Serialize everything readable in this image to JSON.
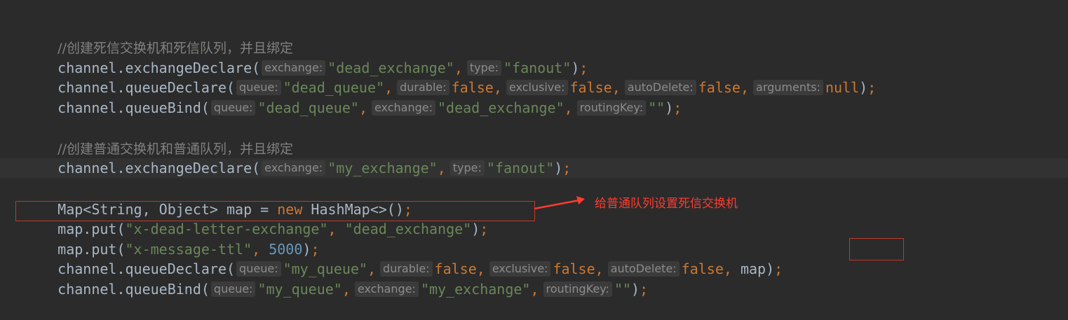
{
  "code": {
    "comment1": "//创建死信交换机和死信队列，并且绑定",
    "line_exchange_dead": {
      "method": "channel.exchangeDeclare(",
      "hint_exchange": "exchange:",
      "val_exchange": "\"dead_exchange\"",
      "hint_type": "type:",
      "val_type": "\"fanout\"",
      "end": ");"
    },
    "line_queue_dead": {
      "method": "channel.queueDeclare(",
      "hint_queue": "queue:",
      "val_queue": "\"dead_queue\"",
      "hint_durable": "durable:",
      "val_durable": "false",
      "hint_exclusive": "exclusive:",
      "val_exclusive": "false",
      "hint_autodelete": "autoDelete:",
      "val_autodelete": "false",
      "hint_arguments": "arguments:",
      "val_arguments": "null",
      "end": ");"
    },
    "line_bind_dead": {
      "method": "channel.queueBind(",
      "hint_queue": "queue:",
      "val_queue": "\"dead_queue\"",
      "hint_exchange": "exchange:",
      "val_exchange": "\"dead_exchange\"",
      "hint_routing": "routingKey:",
      "val_routing": "\"\"",
      "end": ");"
    },
    "comment2": "//创建普通交换机和普通队列，并且绑定",
    "line_exchange_my": {
      "method": "channel.exchangeDeclare(",
      "hint_exchange": "exchange:",
      "val_exchange": "\"my_exchange\"",
      "hint_type": "type:",
      "val_type": "\"fanout\"",
      "end": ");"
    },
    "line_map_decl": {
      "type": "Map<String, Object> map = ",
      "kw_new": "new",
      "ctor": " HashMap<>()",
      "end": ";"
    },
    "line_put_dlx": {
      "method": "map.put(",
      "key": "\"x-dead-letter-exchange\"",
      "comma": ", ",
      "value": "\"dead_exchange\"",
      "end": ");"
    },
    "line_put_ttl": {
      "method": "map.put(",
      "key": "\"x-message-ttl\"",
      "comma": ", ",
      "value": "5000",
      "end": ");"
    },
    "line_queue_my": {
      "method": "channel.queueDeclare(",
      "hint_queue": "queue:",
      "val_queue": "\"my_queue\"",
      "hint_durable": "durable:",
      "val_durable": "false",
      "hint_exclusive": "exclusive:",
      "val_exclusive": "false",
      "hint_autodelete": "autoDelete:",
      "val_autodelete": "false",
      "arg_map": " map",
      "end": ");"
    },
    "line_bind_my": {
      "method": "channel.queueBind(",
      "hint_queue": "queue:",
      "val_queue": "\"my_queue\"",
      "hint_exchange": "exchange:",
      "val_exchange": "\"my_exchange\"",
      "hint_routing": "routingKey:",
      "val_routing": "\"\"",
      "end": ");"
    }
  },
  "annotation": {
    "text": "给普通队列设置死信交换机",
    "color": "#ff3b30"
  }
}
